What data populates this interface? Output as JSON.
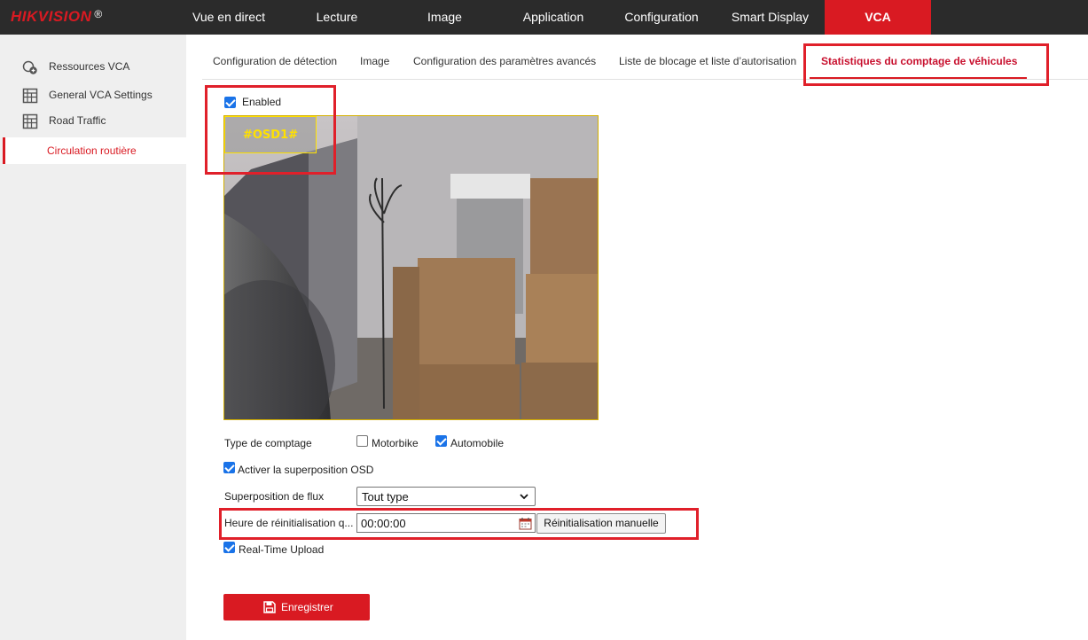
{
  "brand": {
    "logo_text": "HIKVISION",
    "registered": "®",
    "accent": "#d91a22"
  },
  "topnav": [
    {
      "label": "Vue en direct"
    },
    {
      "label": "Lecture"
    },
    {
      "label": "Image"
    },
    {
      "label": "Application"
    },
    {
      "label": "Configuration"
    },
    {
      "label": "Smart Display"
    },
    {
      "label": "VCA",
      "active": true
    }
  ],
  "sidebar": {
    "items": [
      {
        "label": "Ressources VCA",
        "icon": "resources-icon"
      },
      {
        "label": "General VCA Settings",
        "icon": "grid-settings-icon"
      },
      {
        "label": "Road Traffic",
        "icon": "grid-traffic-icon"
      }
    ],
    "sub_item": {
      "label": "Circulation routière",
      "active": true
    }
  },
  "tabs": [
    {
      "label": "Configuration de détection"
    },
    {
      "label": "Image"
    },
    {
      "label": "Configuration des paramètres avancés"
    },
    {
      "label": "Liste de blocage et liste d’autorisation"
    },
    {
      "label": "Statistiques du comptage de véhicules",
      "active": true
    }
  ],
  "form": {
    "enabled": {
      "label": "Enabled",
      "checked": true
    },
    "osd_text": "#OSD1#",
    "counting_type": {
      "label": "Type de comptage",
      "options": [
        {
          "label": "Motorbike",
          "checked": false
        },
        {
          "label": "Automobile",
          "checked": true
        }
      ]
    },
    "osd_overlay": {
      "label": "Activer la superposition OSD",
      "checked": true
    },
    "flux": {
      "label": "Superposition de flux",
      "value": "Tout type"
    },
    "reset_time": {
      "label": "Heure de réinitialisation q...",
      "value": "00:00:00"
    },
    "manual_reset": {
      "label": "Réinitialisation manuelle"
    },
    "realtime_upload": {
      "label": "Real-Time Upload",
      "checked": true
    },
    "save": {
      "label": "Enregistrer"
    }
  },
  "colors": {
    "checkbox": "#1a73e8",
    "highlight_box": "#e0202a",
    "osd": "#ffe100"
  }
}
